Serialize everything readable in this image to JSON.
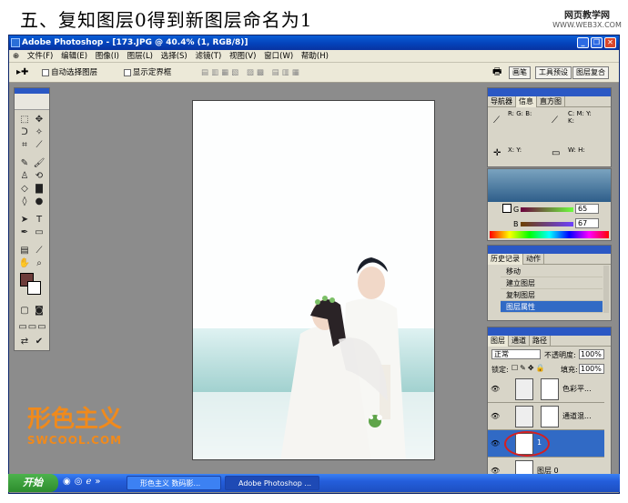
{
  "tutorial": {
    "step_title": "五、复知图层0得到新图层命名为1"
  },
  "site_logo": {
    "line1": "网页教学网",
    "line2": "WWW.WEB3X.COM"
  },
  "window": {
    "title": "Adobe Photoshop - [173.JPG @ 40.4% (1, RGB/8)]"
  },
  "menu": [
    "文件(F)",
    "编辑(E)",
    "图像(I)",
    "图层(L)",
    "选择(S)",
    "滤镜(T)",
    "视图(V)",
    "窗口(W)",
    "帮助(H)"
  ],
  "options": {
    "auto_select": "自动选择图层",
    "show_bounds": "显示定界框",
    "btn_brushes": "画笔",
    "btn_presets": "工具预设",
    "btn_comps": "图层复合"
  },
  "info_panel": {
    "tabs": [
      "导航器",
      "信息",
      "直方图"
    ],
    "rgb": "R: G: B:",
    "cmyk": "C: M: Y: K:",
    "xy": "X: Y:",
    "wh": "W: H:"
  },
  "color_panel": {
    "g_label": "G",
    "g_value": "65",
    "b_label": "B",
    "b_value": "67"
  },
  "history_panel": {
    "tabs": [
      "历史记录",
      "动作"
    ],
    "items": [
      "移动",
      "建立图层",
      "复制图层",
      "图层属性"
    ]
  },
  "layers_panel": {
    "tabs": [
      "图层",
      "通道",
      "路径"
    ],
    "blend_mode": "正常",
    "opacity_label": "不透明度:",
    "opacity": "100%",
    "lock_label": "锁定:",
    "fill_label": "填充:",
    "fill": "100%",
    "layers": [
      "色彩平...",
      "通道混...",
      "1",
      "图层 0"
    ]
  },
  "watermark": {
    "brand": "形色主义",
    "url": "SWCOOL.COM"
  },
  "taskbar": {
    "start": "开始",
    "task1": "形色主义 数码影...",
    "task2": "Adobe Photoshop ..."
  },
  "colors": {
    "accent": "#2b58c4",
    "selected_layer": "#316ac5",
    "watermark": "#f08a1c"
  }
}
